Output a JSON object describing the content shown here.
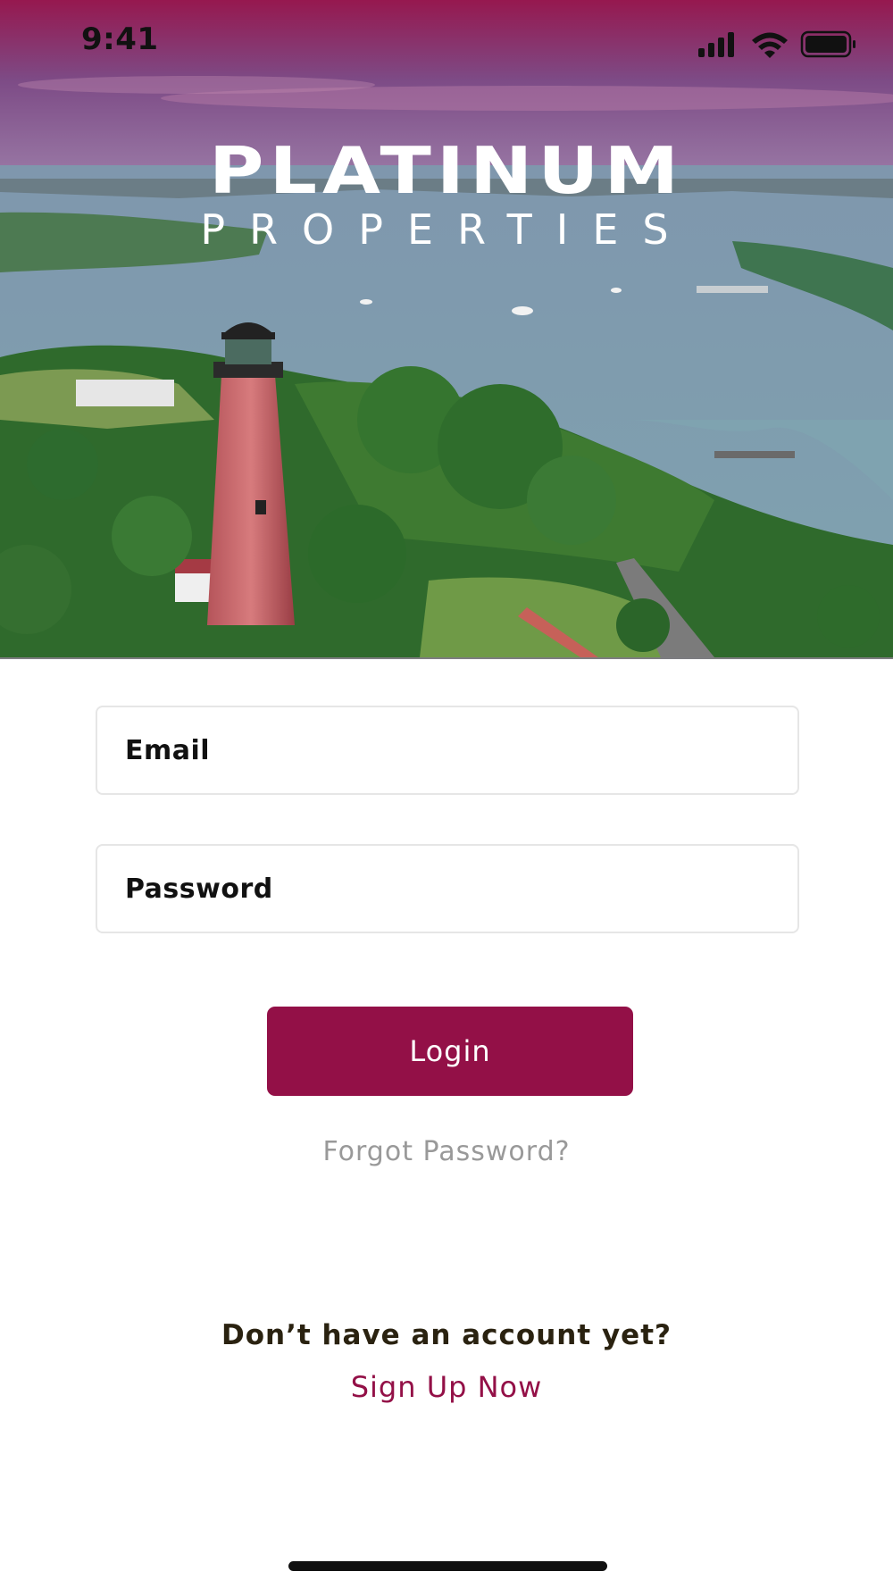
{
  "status_bar": {
    "time": "9:41",
    "icons": [
      "signal-icon",
      "wifi-icon",
      "battery-icon"
    ]
  },
  "hero": {
    "logo_line1": "PLATINUM",
    "logo_line2": "PROPERTIES"
  },
  "form": {
    "email_placeholder": "Email",
    "password_placeholder": "Password",
    "login_label": "Login",
    "forgot_label": "Forgot Password?"
  },
  "footer": {
    "no_account_text": "Don’t have an account yet?",
    "signup_label": "Sign Up Now"
  },
  "colors": {
    "brand": "#931047",
    "muted": "#999999",
    "dark_text": "#2a2210"
  }
}
